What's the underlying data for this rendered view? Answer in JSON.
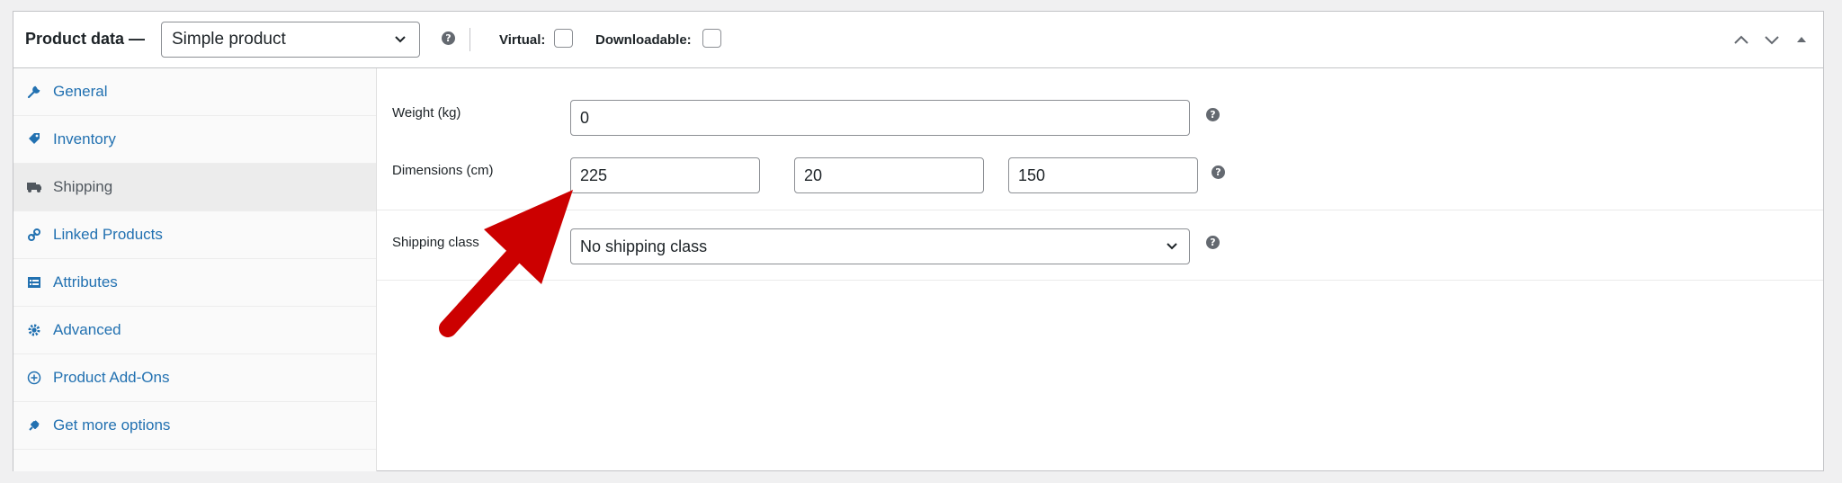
{
  "header": {
    "title": "Product data —",
    "product_type": "Simple product",
    "virtual_label": "Virtual:",
    "downloadable_label": "Downloadable:",
    "help_glyph": "?"
  },
  "sidebar": {
    "items": [
      {
        "label": "General",
        "icon": "wrench-icon"
      },
      {
        "label": "Inventory",
        "icon": "tag-icon"
      },
      {
        "label": "Shipping",
        "icon": "truck-icon",
        "active": true
      },
      {
        "label": "Linked Products",
        "icon": "link-icon"
      },
      {
        "label": "Attributes",
        "icon": "list-icon"
      },
      {
        "label": "Advanced",
        "icon": "gear-icon"
      },
      {
        "label": "Product Add-Ons",
        "icon": "plus-circle-icon"
      },
      {
        "label": "Get more options",
        "icon": "plugin-icon"
      }
    ]
  },
  "shipping": {
    "weight_label": "Weight (kg)",
    "weight_value": "0",
    "dimensions_label": "Dimensions (cm)",
    "length": "225",
    "width": "20",
    "height": "150",
    "class_label": "Shipping class",
    "class_value": "No shipping class"
  },
  "colors": {
    "accent": "#2271b1",
    "annotation_arrow": "#cc0000"
  }
}
